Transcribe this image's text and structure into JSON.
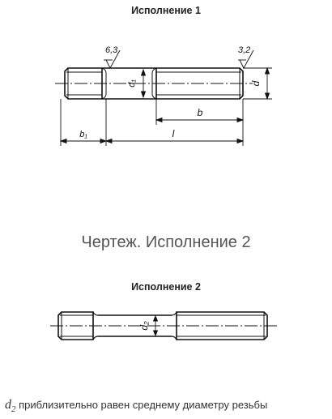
{
  "figure1": {
    "title": "Исполнение 1",
    "roughness_left": "6,3",
    "roughness_right": "3,2",
    "dim_d1": "d₁",
    "dim_d": "d",
    "dim_b": "b",
    "dim_b1": "b₁",
    "dim_l": "l"
  },
  "caption": "Чертеж. Исполнение 2",
  "figure2": {
    "title": "Исполнение 2",
    "dim_d2": "d₂"
  },
  "note": {
    "symbol": "d",
    "symbol_sub": "2",
    "text": " приблизительно равен среднему диаметру резьбы"
  }
}
